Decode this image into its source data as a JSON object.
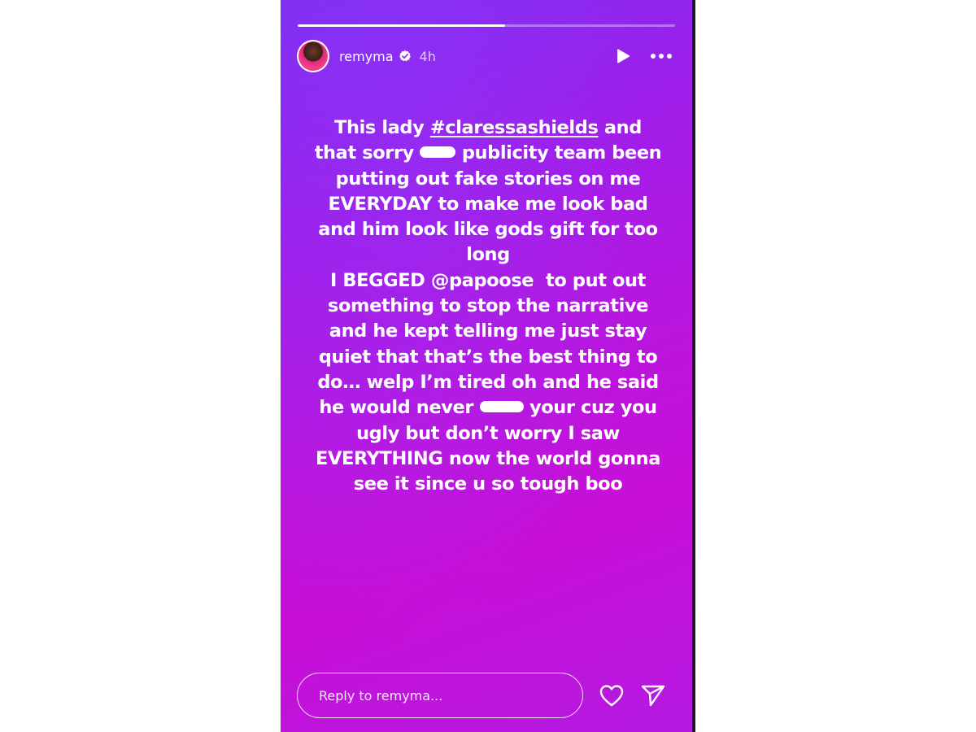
{
  "story": {
    "progress": 0.55,
    "gradient_colors": [
      "#7f2ff2",
      "#a21de8",
      "#c70fd7"
    ],
    "accent_color": "#ffffff"
  },
  "header": {
    "avatar_icon": "profile-photo",
    "username": "remyma",
    "verified_icon": "verified-badge-icon",
    "time": "4h",
    "play_icon": "play-icon",
    "more_icon": "more-options-icon"
  },
  "caption": {
    "l1_a": "This lady ",
    "hashtag": "#claressashields",
    "l1_b": " and",
    "l2_a": "that sorry ",
    "l2_b": " publicity team been",
    "l3": "putting out fake stories on me",
    "l4": "EVERYDAY to make me look bad",
    "l5": "and him look like gods gift for too",
    "l6": "long",
    "l7_a": "I BEGGED ",
    "mention": "@papoose",
    "l7_b": "  to put out",
    "l8": "something to stop the narrative",
    "l9": "and he kept telling me just stay",
    "l10": "quiet that that’s the best thing to",
    "l11": "do… welp I’m tired oh and he said",
    "l12_a": "he would never ",
    "l12_b": " your cuz you",
    "l13": "ugly but don’t worry I saw",
    "l14": "EVERYTHING now the world gonna",
    "l15": "see it since u so tough boo"
  },
  "footer": {
    "reply_placeholder": "Reply to remyma...",
    "like_icon": "heart-icon",
    "share_icon": "send-icon"
  }
}
